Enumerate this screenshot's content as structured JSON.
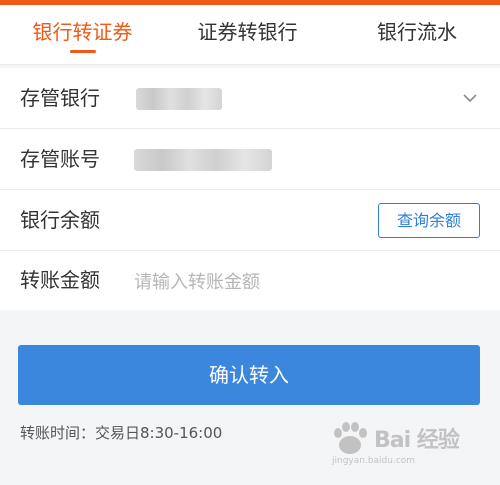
{
  "tabs": [
    {
      "label": "银行转证券",
      "active": true
    },
    {
      "label": "证券转银行",
      "active": false
    },
    {
      "label": "银行流水",
      "active": false
    }
  ],
  "form": {
    "bank_label": "存管银行",
    "account_label": "存管账号",
    "balance_label": "银行余额",
    "query_balance_label": "查询余额",
    "amount_label": "转账金额",
    "amount_placeholder": "请输入转账金额",
    "amount_value": ""
  },
  "confirm_label": "确认转入",
  "hint": "转账时间：交易日8:30-16:00",
  "watermark": {
    "text": "Bai 经验",
    "url": "jingyan.baidu.com"
  },
  "colors": {
    "accent": "#f05a14",
    "primary": "#3a87dd",
    "link": "#2f7fd5"
  },
  "icons": [
    "chevron-down-icon",
    "baidu-paw-icon"
  ]
}
